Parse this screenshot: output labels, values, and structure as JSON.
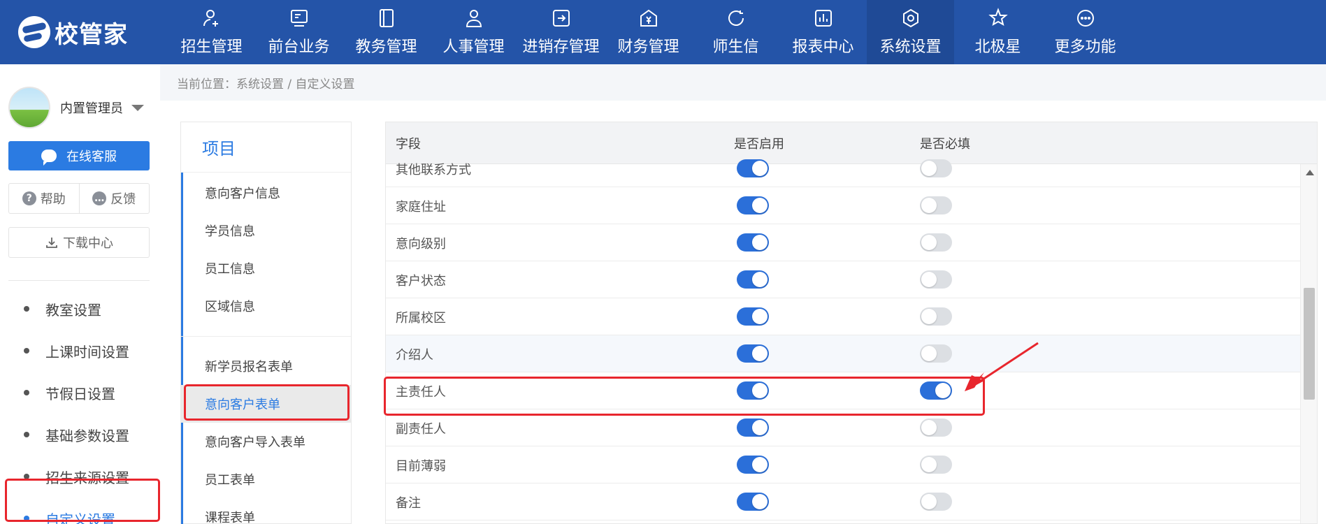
{
  "brand": {
    "name": "校管家"
  },
  "nav": [
    {
      "label": "招生管理",
      "icon": "user-add-icon"
    },
    {
      "label": "前台业务",
      "icon": "front-desk-icon"
    },
    {
      "label": "教务管理",
      "icon": "book-icon"
    },
    {
      "label": "人事管理",
      "icon": "person-icon"
    },
    {
      "label": "进销存管理",
      "icon": "inventory-icon"
    },
    {
      "label": "财务管理",
      "icon": "finance-icon"
    },
    {
      "label": "师生信",
      "icon": "message-icon"
    },
    {
      "label": "报表中心",
      "icon": "report-icon"
    },
    {
      "label": "系统设置",
      "icon": "settings-icon",
      "active": true
    },
    {
      "label": "北极星",
      "icon": "star-icon"
    },
    {
      "label": "更多功能",
      "icon": "more-icon"
    }
  ],
  "sidebar": {
    "user_name": "内置管理员",
    "online_service": "在线客服",
    "help": "帮助",
    "feedback": "反馈",
    "download_center": "下载中心",
    "menu": [
      {
        "label": "教室设置"
      },
      {
        "label": "上课时间设置"
      },
      {
        "label": "节假日设置"
      },
      {
        "label": "基础参数设置"
      },
      {
        "label": "招生来源设置"
      },
      {
        "label": "自定义设置",
        "active": true
      }
    ]
  },
  "breadcrumb": "当前位置：系统设置 / 自定义设置",
  "project": {
    "title": "项目",
    "items": [
      {
        "label": "意向客户信息"
      },
      {
        "label": "学员信息"
      },
      {
        "label": "员工信息"
      },
      {
        "label": "区域信息"
      },
      {
        "label": "新学员报名表单"
      },
      {
        "label": "意向客户表单",
        "active": true
      },
      {
        "label": "意向客户导入表单"
      },
      {
        "label": "员工表单"
      },
      {
        "label": "课程表单"
      }
    ]
  },
  "table": {
    "headers": {
      "field": "字段",
      "enabled": "是否启用",
      "required": "是否必填"
    },
    "rows": [
      {
        "field": "其他联系方式",
        "enabled": true,
        "required": false
      },
      {
        "field": "家庭住址",
        "enabled": true,
        "required": false
      },
      {
        "field": "意向级别",
        "enabled": true,
        "required": false
      },
      {
        "field": "客户状态",
        "enabled": true,
        "required": false
      },
      {
        "field": "所属校区",
        "enabled": true,
        "required": false
      },
      {
        "field": "介绍人",
        "enabled": true,
        "required": false
      },
      {
        "field": "主责任人",
        "enabled": true,
        "required": true
      },
      {
        "field": "副责任人",
        "enabled": true,
        "required": false
      },
      {
        "field": "目前薄弱",
        "enabled": true,
        "required": false
      },
      {
        "field": "备注",
        "enabled": true,
        "required": false
      }
    ]
  },
  "colors": {
    "nav_bg": "#2454a8",
    "accent": "#2b7be2",
    "toggle_on": "#2b6fd9",
    "highlight": "#e8262d"
  }
}
